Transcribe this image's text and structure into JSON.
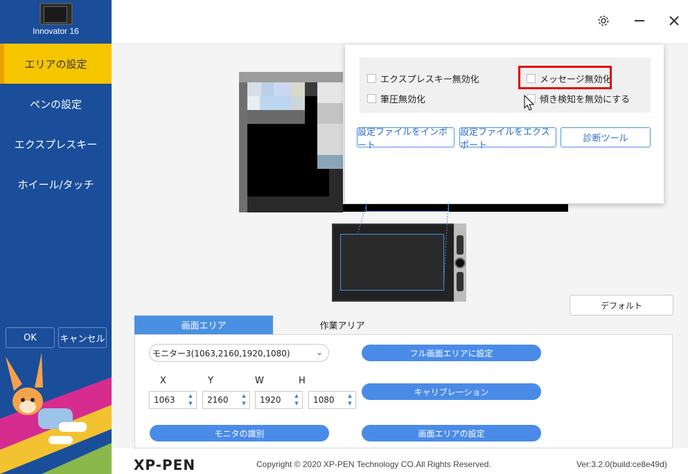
{
  "sidebar": {
    "device_name": "Innovator 16",
    "items": [
      {
        "label": "エリアの設定",
        "active": true
      },
      {
        "label": "ペンの設定",
        "active": false
      },
      {
        "label": "エクスプレスキー",
        "active": false
      },
      {
        "label": "ホイール/タッチ",
        "active": false
      }
    ],
    "ok_label": "OK",
    "cancel_label": "キャンセル"
  },
  "header": {
    "icons": [
      "gear-icon",
      "minimize-icon",
      "close-icon"
    ]
  },
  "settings_popup": {
    "options": {
      "express_key_disable": "エクスプレスキー無効化",
      "message_disable": "メッセージ無効化",
      "pressure_disable": "筆圧無効化",
      "tilt_disable": "傾き検知を無効にする"
    },
    "buttons": {
      "import": "設定ファイルをインポート",
      "export": "設定ファイルをエクスポート",
      "diagnostic": "診断ツール"
    }
  },
  "main": {
    "default_label": "デフォルト",
    "tabs": {
      "screen_area": "画面エリア",
      "work_area": "作業アリア"
    },
    "monitor_select": "モニター3(1063,2160,1920,1080)",
    "coords": {
      "x_label": "X",
      "y_label": "Y",
      "w_label": "W",
      "h_label": "H",
      "x_value": "1063",
      "y_value": "2160",
      "w_value": "1920",
      "h_value": "1080"
    },
    "buttons": {
      "full_screen": "フル画面エリアに設定",
      "calibration": "キャリブレーション",
      "identify_monitor": "モニタの識別",
      "screen_area_setting": "画面エリアの設定"
    }
  },
  "footer": {
    "logo": "XP-PEN",
    "copyright": "Copyright © 2020 XP-PEN Technology CO.All Rights Reserved.",
    "version": "Ver:3.2.0(build:ce8e49d)"
  },
  "colors": {
    "sidebar_bg": "#1a4e9a",
    "active_nav": "#f5c500",
    "accent_blue": "#4a8be8",
    "highlight_red": "#e00000"
  }
}
